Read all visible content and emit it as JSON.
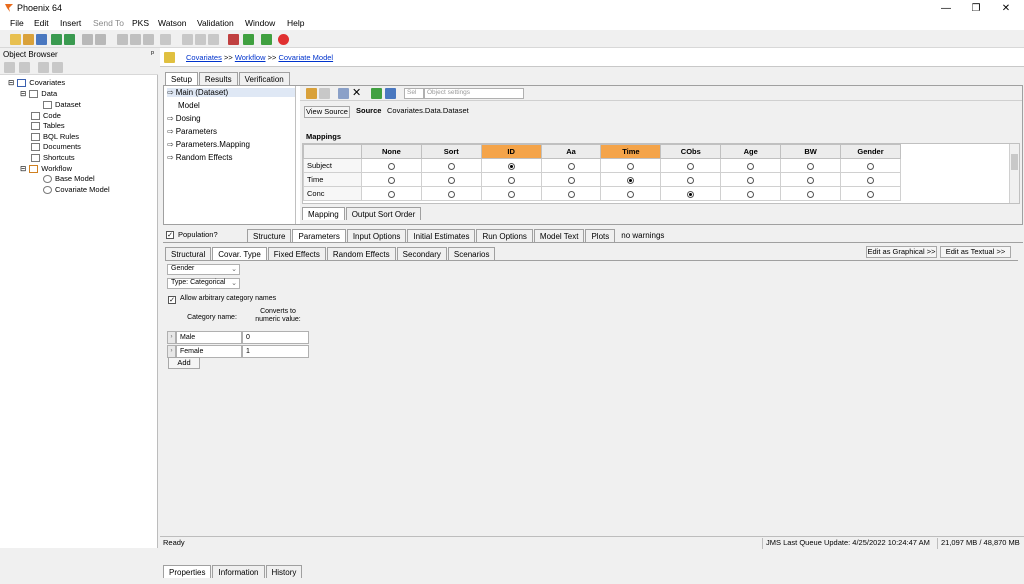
{
  "window": {
    "title": "Phoenix 64",
    "controls": [
      "—",
      "❐",
      "✕"
    ]
  },
  "menu": [
    "File",
    "Edit",
    "Insert",
    "Send To",
    "PKS",
    "Watson",
    "Validation",
    "Window",
    "Help"
  ],
  "object_browser": {
    "title": "Object Browser",
    "pin": "ᵖ",
    "tree": {
      "project": "Covariates",
      "data": "Data",
      "dataset": "Dataset",
      "code": "Code",
      "tables": "Tables",
      "bql": "BQL Rules",
      "documents": "Documents",
      "shortcuts": "Shortcuts",
      "workflow": "Workflow",
      "base_model": "Base Model",
      "covariate_model": "Covariate Model"
    }
  },
  "breadcrumb": {
    "items": [
      "Covariates",
      "Workflow",
      "Covariate Model"
    ],
    "sep": ">>"
  },
  "top_tabs": [
    "Setup",
    "Results",
    "Verification"
  ],
  "setup_list": [
    "Main (Dataset)",
    "Model",
    "Dosing",
    "Parameters",
    "Parameters.Mapping",
    "Random Effects"
  ],
  "source": {
    "button": "View Source",
    "label": "Source",
    "value": "Covariates.Data.Dataset",
    "select_placeholder": "Sel",
    "settings_placeholder": "Object settings"
  },
  "mappings": {
    "title": "Mappings",
    "columns": [
      "None",
      "Sort",
      "ID",
      "Aa",
      "Time",
      "CObs",
      "Age",
      "BW",
      "Gender"
    ],
    "highlighted": [
      "ID",
      "Time"
    ],
    "rows": [
      {
        "name": "Subject",
        "selected": "ID"
      },
      {
        "name": "Time",
        "selected": "Time"
      },
      {
        "name": "Conc",
        "selected": "CObs"
      }
    ],
    "tabs": [
      "Mapping",
      "Output Sort Order"
    ]
  },
  "population": {
    "label": "Population?",
    "checked": true
  },
  "model_tabs": [
    "Structure",
    "Parameters",
    "Input Options",
    "Initial Estimates",
    "Run Options",
    "Model Text",
    "Plots",
    "no warnings"
  ],
  "param_tabs": [
    "Structural",
    "Covar. Type",
    "Fixed Effects",
    "Random Effects",
    "Secondary",
    "Scenarios"
  ],
  "edit_buttons": [
    "Edit as Graphical >>",
    "Edit as Textual >>"
  ],
  "covariate": {
    "name": "Gender",
    "type": "Type: Categorical",
    "allow_arbitrary": "Allow arbitrary category names",
    "col_name": "Category name:",
    "col_converts": "Converts to numeric value:",
    "rows": [
      {
        "name": "Male",
        "value": "0"
      },
      {
        "name": "Female",
        "value": "1"
      }
    ],
    "add": "Add"
  },
  "bottom_tabs": [
    "Properties",
    "Information",
    "History"
  ],
  "status": {
    "ready": "Ready",
    "queue": "JMS Last Queue Update: 4/25/2022 10:24:47 AM",
    "memory": "21,097 MB / 48,870 MB"
  }
}
